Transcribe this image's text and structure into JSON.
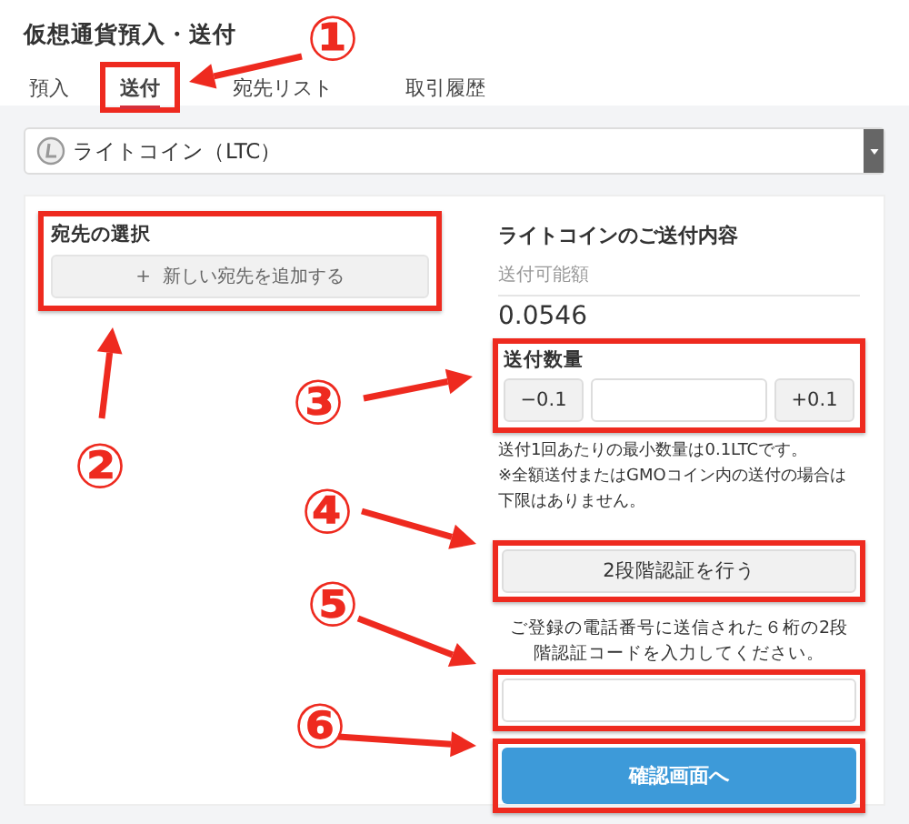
{
  "page": {
    "title": "仮想通貨預入・送付"
  },
  "tabs": [
    {
      "label": "預入",
      "selected": false,
      "highlighted": false
    },
    {
      "label": "送付",
      "selected": true,
      "highlighted": true
    },
    {
      "label": "宛先リスト",
      "selected": false,
      "highlighted": false
    },
    {
      "label": "取引履歴",
      "selected": false,
      "highlighted": false
    }
  ],
  "currency_select": {
    "value": "ライトコイン（LTC）"
  },
  "destination": {
    "heading": "宛先の選択",
    "add_button": {
      "icon": "+",
      "label": "新しい宛先を追加する"
    },
    "highlighted": true
  },
  "send": {
    "heading": "ライトコインのご送付内容",
    "available_label": "送付可能額",
    "available_value": "0.0546",
    "amount": {
      "label": "送付数量",
      "minus": "−0.1",
      "plus": "+0.1",
      "highlighted": true
    },
    "notes": [
      "送付1回あたりの最小数量は0.1LTCです。",
      "※全額送付またはGMOコイン内の送付の場合は下限はありません。"
    ],
    "auth_button": {
      "label": "2段階認証を行う",
      "highlighted": true
    },
    "code_instruction": "ご登録の電話番号に送信された６桁の2段階認証コードを入力してください。",
    "code_field": {
      "highlighted": true
    },
    "confirm_button": {
      "label": "確認画面へ",
      "highlighted": true
    }
  },
  "annotations": [
    {
      "label": "①"
    },
    {
      "label": "②"
    },
    {
      "label": "③"
    },
    {
      "label": "④"
    },
    {
      "label": "⑤"
    },
    {
      "label": "⑥"
    }
  ]
}
